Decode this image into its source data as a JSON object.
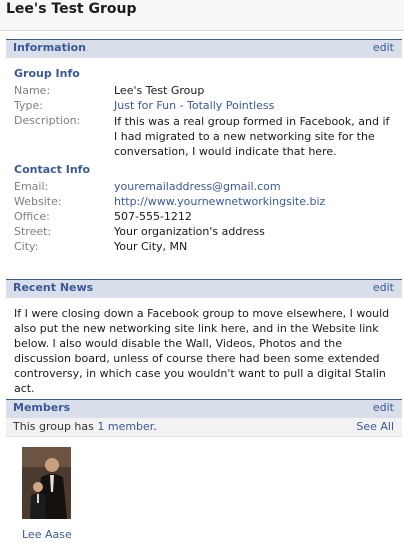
{
  "page": {
    "title": "Lee's Test Group"
  },
  "information": {
    "title": "Information",
    "edit_label": "edit",
    "group_info": {
      "heading": "Group Info",
      "name_label": "Name:",
      "name_value": "Lee's Test Group",
      "type_label": "Type:",
      "type_value": "Just for Fun - Totally Pointless",
      "description_label": "Description:",
      "description_value": "If this was a real group formed in Facebook, and if I had migrated to a new networking site for the conversation, I would indicate that here."
    },
    "contact_info": {
      "heading": "Contact Info",
      "email_label": "Email:",
      "email_value": "youremailaddress@gmail.com",
      "website_label": "Website:",
      "website_value": "http://www.yournewnetworkingsite.biz",
      "office_label": "Office:",
      "office_value": "507-555-1212",
      "street_label": "Street:",
      "street_value": "Your organization's address",
      "city_label": "City:",
      "city_value": "Your City, MN"
    }
  },
  "recent_news": {
    "title": "Recent News",
    "edit_label": "edit",
    "text": "If I were closing down a Facebook group to move elsewhere, I would also put the new networking site link here, and in the Website link below. I also would disable the Wall, Videos, Photos and the discussion board, unless of course there had been some extended controversy, in which case you wouldn't want to pull a digital Stalin act."
  },
  "members": {
    "title": "Members",
    "edit_label": "edit",
    "count_prefix": "This group has ",
    "count_link": "1 member",
    "count_suffix": ".",
    "see_all_label": "See All",
    "list": [
      {
        "name": "Lee Aase"
      }
    ]
  },
  "colors": {
    "link": "#3b5998",
    "section_bg": "#d8dfea",
    "label": "#7f7f7f"
  }
}
